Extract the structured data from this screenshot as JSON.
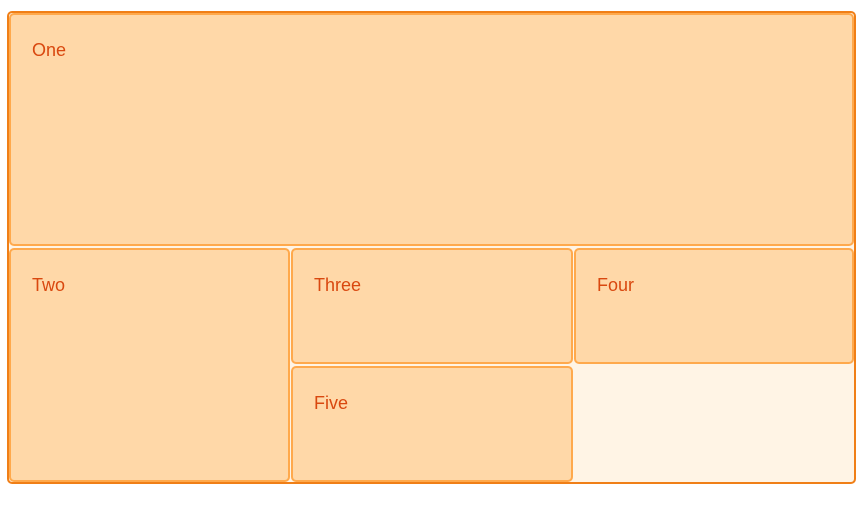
{
  "grid": {
    "items": [
      {
        "label": "One"
      },
      {
        "label": "Two"
      },
      {
        "label": "Three"
      },
      {
        "label": "Four"
      },
      {
        "label": "Five"
      }
    ]
  },
  "colors": {
    "wrapper_border": "#f07f17",
    "wrapper_background": "#fff4e5",
    "cell_border": "#ffa94c",
    "cell_background": "#ffd8a8",
    "cell_text": "#d9480f"
  }
}
